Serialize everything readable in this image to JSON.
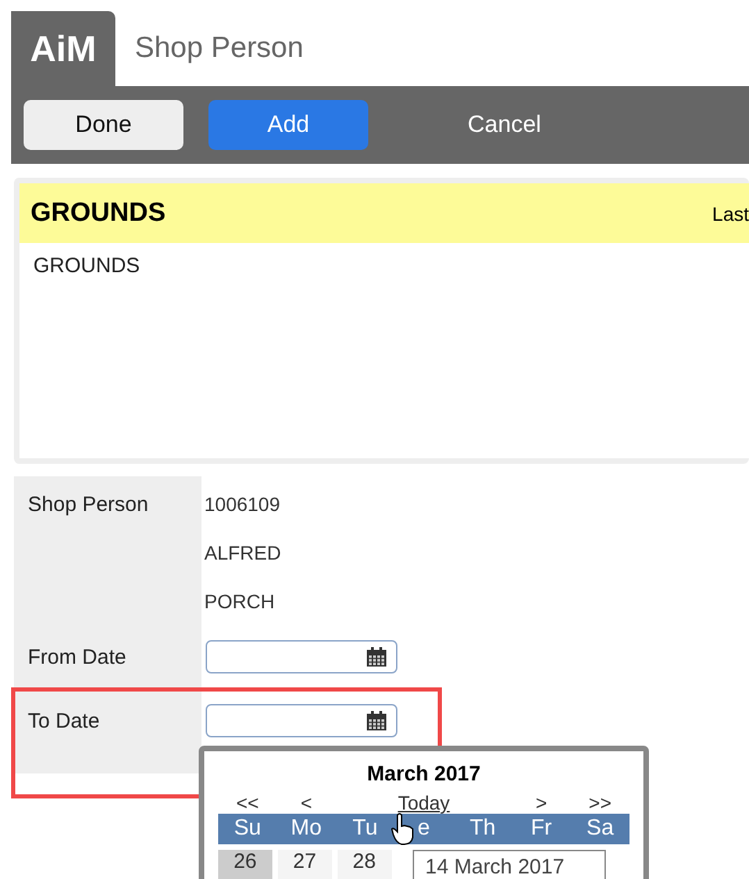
{
  "app": {
    "logo": "AiM",
    "title": "Shop Person"
  },
  "toolbar": [
    {
      "label": "Done",
      "kind": "plain"
    },
    {
      "label": "Add",
      "kind": "primary"
    },
    {
      "label": "Cancel",
      "kind": "link"
    }
  ],
  "record": {
    "heading": "GROUNDS",
    "side_label": "Last",
    "description": "GROUNDS"
  },
  "form": [
    {
      "label": "Shop Person",
      "kind": "values",
      "values": [
        "1006109",
        "ALFRED",
        "PORCH"
      ]
    },
    {
      "label": "From Date",
      "kind": "date",
      "highlighted": false
    },
    {
      "label": "To Date",
      "kind": "date",
      "highlighted": true
    }
  ],
  "calendar": {
    "month": "March 2017",
    "nav": [
      "<<",
      "<",
      "Today",
      ">",
      ">>"
    ],
    "weekdays": [
      "Su",
      "Mo",
      "Tu",
      "e",
      "Th",
      "Fr",
      "Sa"
    ],
    "days": [
      {
        "label": "26",
        "kind": "weekend"
      },
      {
        "label": "27",
        "kind": "weekday"
      },
      {
        "label": "28",
        "kind": "weekday"
      }
    ],
    "tooltip": "14 March 2017"
  }
}
